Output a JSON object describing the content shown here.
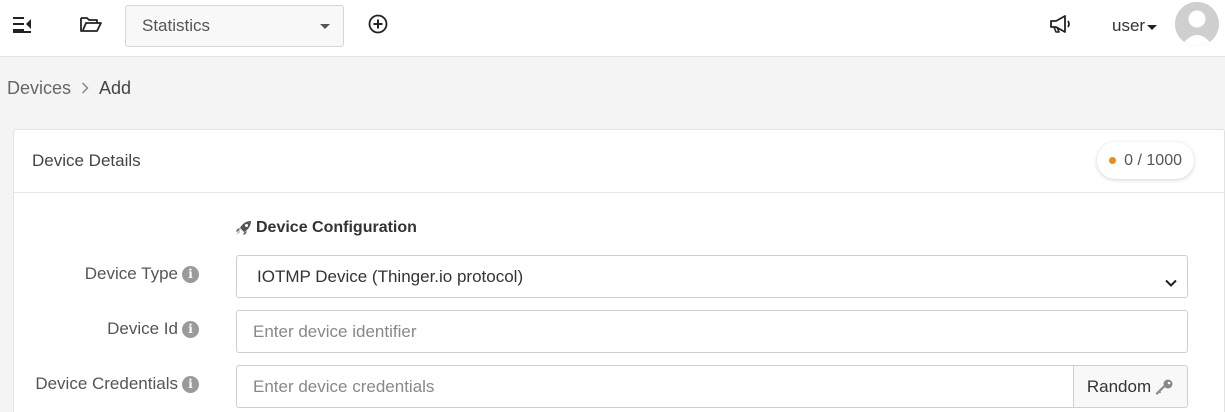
{
  "header": {
    "dashboard_select": {
      "value": "Statistics"
    },
    "user": {
      "name": "user"
    }
  },
  "breadcrumb": {
    "items": [
      {
        "label": "Devices"
      },
      {
        "label": "Add"
      }
    ]
  },
  "card": {
    "title": "Device Details",
    "quota": {
      "text": "0 / 1000",
      "dot_color": "#f0891c"
    },
    "section_heading": "Device Configuration",
    "fields": {
      "device_type": {
        "label": "Device Type",
        "value": "IOTMP Device (Thinger.io protocol)"
      },
      "device_id": {
        "label": "Device Id",
        "placeholder": "Enter device identifier"
      },
      "device_credentials": {
        "label": "Device Credentials",
        "placeholder": "Enter device credentials",
        "random_label": "Random"
      }
    }
  },
  "icons": {
    "menu_toggle": "menu-collapse-icon",
    "folder": "folder-open-icon",
    "add": "plus-circle-icon",
    "announce": "megaphone-icon",
    "avatar": "user-avatar-icon",
    "breadcrumb_separator": "chevron-right-icon",
    "section": "rocket-icon",
    "info": "info-icon",
    "select_chevron": "chevron-down-icon",
    "random": "key-icon"
  }
}
